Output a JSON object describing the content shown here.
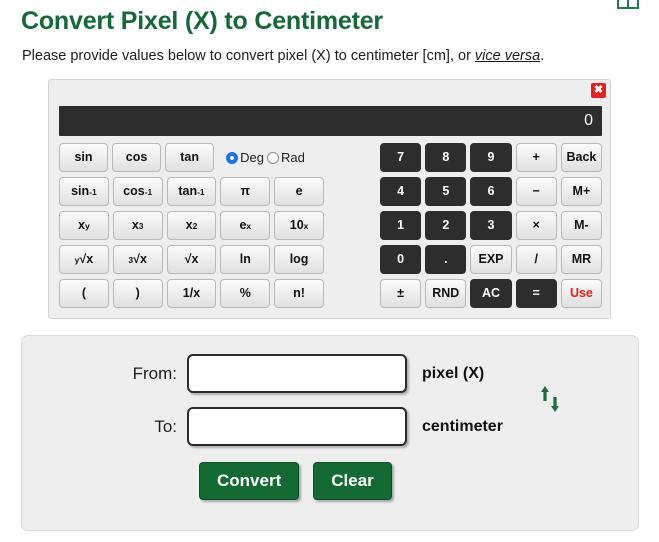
{
  "header": {
    "table_icon": "table-icon",
    "title": "Convert Pixel (X) to Centimeter",
    "subtitle_pre": "Please provide values below to convert pixel (X) to centimeter [cm], or ",
    "subtitle_link": "vice versa",
    "subtitle_post": "."
  },
  "calculator": {
    "close_label": "✖",
    "display_value": "0",
    "angle_mode": {
      "deg_label": "Deg",
      "rad_label": "Rad",
      "selected": "Deg"
    },
    "left_keys": [
      [
        "sin",
        "cos",
        "tan"
      ],
      [
        "sin-1",
        "cos-1",
        "tan-1",
        "π",
        "e"
      ],
      [
        "x^y",
        "x^3",
        "x^2",
        "e^x",
        "10^x"
      ],
      [
        "y√x",
        "3√x",
        "√x",
        "ln",
        "log"
      ],
      [
        "(",
        ")",
        "1/x",
        "%",
        "n!"
      ]
    ],
    "right_keys": [
      [
        "7",
        "8",
        "9",
        "+",
        "Back"
      ],
      [
        "4",
        "5",
        "6",
        "−",
        "M+"
      ],
      [
        "1",
        "2",
        "3",
        "×",
        "M-"
      ],
      [
        "0",
        ".",
        "EXP",
        "/",
        "MR"
      ],
      [
        "±",
        "RND",
        "AC",
        "=",
        "Use"
      ]
    ],
    "labels": {
      "sin": "sin",
      "cos": "cos",
      "tan": "tan",
      "sin_inv_base": "sin",
      "cos_inv_base": "cos",
      "tan_inv_base": "tan",
      "inv_exp": "-1",
      "pi": "π",
      "e": "e",
      "x_base": "x",
      "exp_y": "y",
      "exp_3": "3",
      "exp_2": "2",
      "e_base": "e",
      "exp_x": "x",
      "ten_base": "10",
      "root_y_pre": "y",
      "root_3_pre": "3",
      "root_sym": "√",
      "root_x": "x",
      "ln": "ln",
      "log": "log",
      "paren_open": "(",
      "paren_close": ")",
      "reciprocal": "1/x",
      "percent": "%",
      "factorial": "n!",
      "seven": "7",
      "eight": "8",
      "nine": "9",
      "plus": "+",
      "back": "Back",
      "four": "4",
      "five": "5",
      "six": "6",
      "minus": "−",
      "mplus": "M+",
      "one": "1",
      "two": "2",
      "three": "3",
      "times": "×",
      "mminus": "M-",
      "zero": "0",
      "dot": ".",
      "exp": "EXP",
      "divide": "/",
      "mr": "MR",
      "plusminus": "±",
      "rnd": "RND",
      "ac": "AC",
      "equals": "=",
      "use": "Use"
    }
  },
  "form": {
    "from_label": "From:",
    "to_label": "To:",
    "from_value": "",
    "to_value": "",
    "from_unit": "pixel (X)",
    "to_unit": "centimeter",
    "swap_icon": "swap-vertical-icon",
    "convert_label": "Convert",
    "clear_label": "Clear"
  },
  "colors": {
    "brand_green": "#14683a",
    "button_green": "#126b33",
    "display_bg": "#2e2d2d",
    "close_red": "#e8221a",
    "radio_blue": "#1a73e8"
  }
}
